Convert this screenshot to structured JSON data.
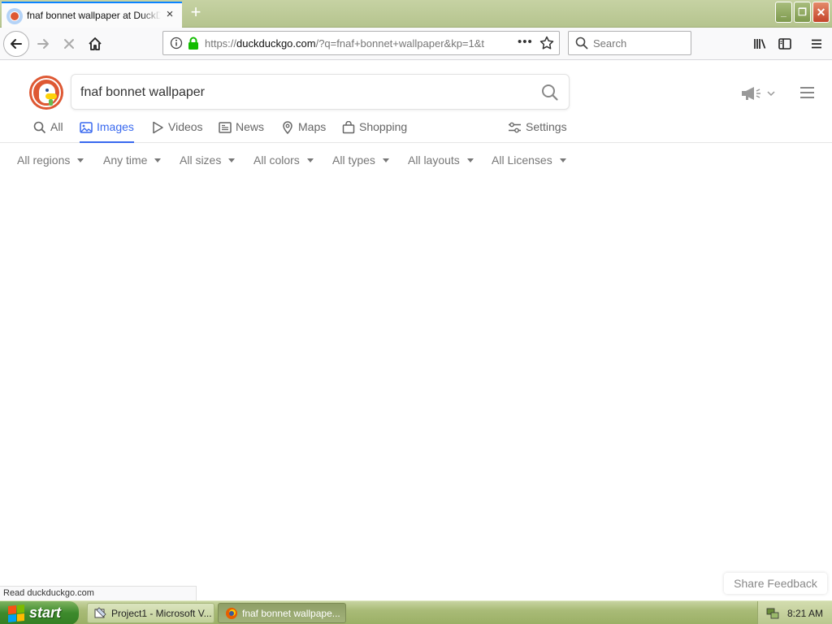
{
  "browser": {
    "tab_title": "fnaf bonnet wallpaper at DuckDuckGo",
    "url_prefix": "https://",
    "url_host": "duckduckgo.com",
    "url_path": "/?q=fnaf+bonnet+wallpaper&kp=1&t",
    "search_placeholder": "Search"
  },
  "page": {
    "query": "fnaf bonnet wallpaper",
    "tabs": [
      {
        "label": "All"
      },
      {
        "label": "Images"
      },
      {
        "label": "Videos"
      },
      {
        "label": "News"
      },
      {
        "label": "Maps"
      },
      {
        "label": "Shopping"
      }
    ],
    "active_tab": "Images",
    "settings_label": "Settings",
    "filters": [
      {
        "label": "All regions"
      },
      {
        "label": "Any time"
      },
      {
        "label": "All sizes"
      },
      {
        "label": "All colors"
      },
      {
        "label": "All types"
      },
      {
        "label": "All layouts"
      },
      {
        "label": "All Licenses"
      }
    ],
    "share_feedback": "Share Feedback"
  },
  "status_text": "Read duckduckgo.com",
  "taskbar": {
    "start_label": "start",
    "tasks": [
      {
        "label": "Project1 - Microsoft V..."
      },
      {
        "label": "fnaf bonnet wallpape..."
      }
    ],
    "clock": "8:21 AM"
  },
  "colors": {
    "ddg_orange": "#de5833",
    "ddg_blue": "#3969ef",
    "xp_green": "#3d8a2c"
  }
}
